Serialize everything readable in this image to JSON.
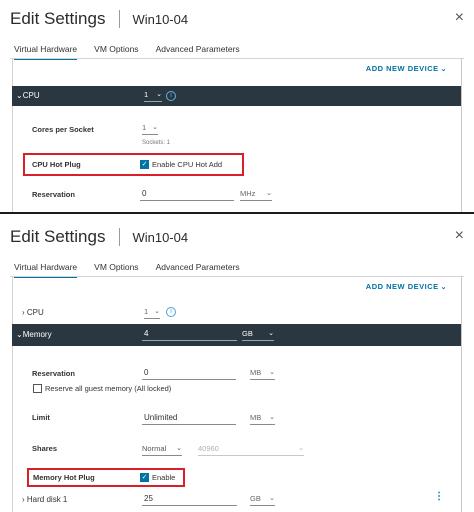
{
  "colors": {
    "accent": "#0072a3",
    "header_row": "#2a3640",
    "highlight": "#d9202a",
    "info": "#49a3d9"
  },
  "panel1": {
    "title": "Edit Settings",
    "vm_name": "Win10-04",
    "close_icon": "×",
    "tabs": [
      "Virtual Hardware",
      "VM Options",
      "Advanced Parameters"
    ],
    "add_new_device": "ADD NEW DEVICE",
    "cpu": {
      "label": "CPU",
      "value": "1"
    },
    "cores_per_socket": {
      "label": "Cores per Socket",
      "value": "1",
      "sockets_text": "Sockets: 1"
    },
    "cpu_hot_plug": {
      "label": "CPU Hot Plug",
      "checkbox_label": "Enable CPU Hot Add",
      "checked": true
    },
    "reservation": {
      "label": "Reservation",
      "value": "0",
      "unit": "MHz"
    }
  },
  "panel2": {
    "title": "Edit Settings",
    "vm_name": "Win10-04",
    "close_icon": "×",
    "tabs": [
      "Virtual Hardware",
      "VM Options",
      "Advanced Parameters"
    ],
    "add_new_device": "ADD NEW DEVICE",
    "cpu": {
      "label": "CPU",
      "value": "1"
    },
    "memory": {
      "label": "Memory",
      "value": "4",
      "unit": "GB"
    },
    "reservation": {
      "label": "Reservation",
      "value": "0",
      "unit": "MB",
      "reserve_all_label": "Reserve all guest memory (All locked)"
    },
    "limit": {
      "label": "Limit",
      "value": "Unlimited",
      "unit": "MB"
    },
    "shares": {
      "label": "Shares",
      "value": "Normal",
      "number": "40960"
    },
    "memory_hot_plug": {
      "label": "Memory Hot Plug",
      "checkbox_label": "Enable",
      "checked": true
    },
    "hard_disk": {
      "label": "Hard disk 1",
      "value": "25",
      "unit": "GB"
    }
  }
}
